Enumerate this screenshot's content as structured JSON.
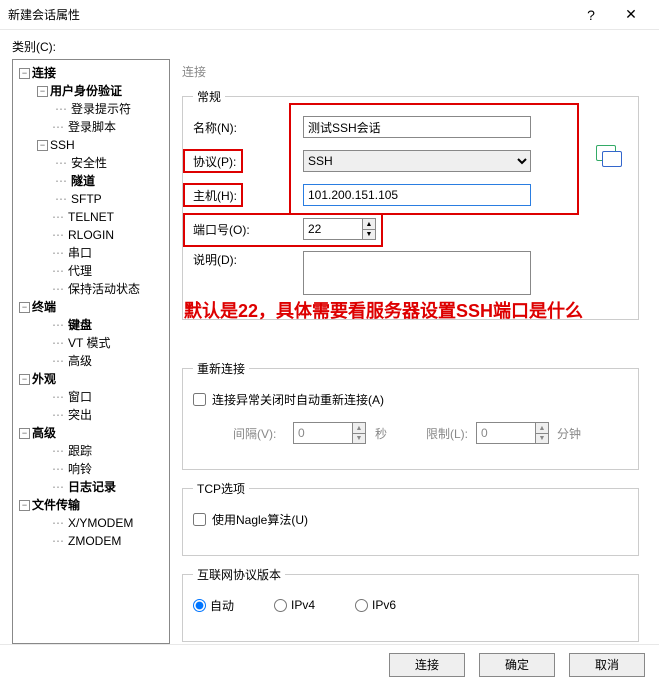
{
  "title": "新建会话属性",
  "category_label": "类别(C):",
  "tree": {
    "connection": "连接",
    "auth": "用户身份验证",
    "login_prompt": "登录提示符",
    "login_script": "登录脚本",
    "ssh": "SSH",
    "security": "安全性",
    "tunnel": "隧道",
    "sftp": "SFTP",
    "telnet": "TELNET",
    "rlogin": "RLOGIN",
    "serial": "串口",
    "proxy": "代理",
    "keepalive": "保持活动状态",
    "terminal": "终端",
    "keyboard": "键盘",
    "vt": "VT 模式",
    "advanced_t": "高级",
    "appearance": "外观",
    "window": "窗口",
    "highlight": "突出",
    "advanced": "高级",
    "trace": "跟踪",
    "bell": "响铃",
    "logging": "日志记录",
    "filetransfer": "文件传输",
    "xymodem": "X/YMODEM",
    "zmodem": "ZMODEM"
  },
  "panel": {
    "breadcrumb": "连接",
    "group_general": "常规",
    "name_label": "名称(N):",
    "name_value": "测试SSH会话",
    "protocol_label": "协议(P):",
    "protocol_value": "SSH",
    "host_label": "主机(H):",
    "host_value": "101.200.151.105",
    "port_label": "端口号(O):",
    "port_value": "22",
    "desc_label": "说明(D):",
    "desc_value": "",
    "group_reconnect": "重新连接",
    "auto_reconnect_label": "连接异常关闭时自动重新连接(A)",
    "interval_label": "间隔(V):",
    "interval_value": "0",
    "interval_unit": "秒",
    "limit_label": "限制(L):",
    "limit_value": "0",
    "limit_unit": "分钟",
    "group_tcp": "TCP选项",
    "nagle_label": "使用Nagle算法(U)",
    "group_ip": "互联网协议版本",
    "ip_auto": "自动",
    "ip_v4": "IPv4",
    "ip_v6": "IPv6"
  },
  "annotation": "默认是22，具体需要看服务器设置SSH端口是什么",
  "buttons": {
    "connect": "连接",
    "ok": "确定",
    "cancel": "取消"
  }
}
